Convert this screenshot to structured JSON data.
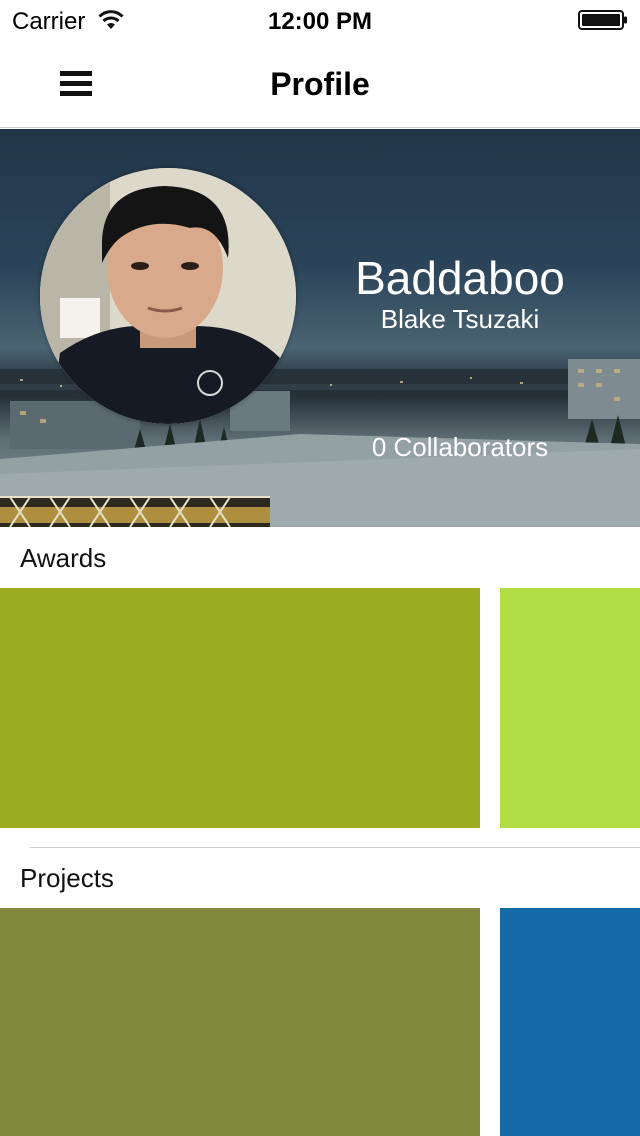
{
  "status_bar": {
    "carrier": "Carrier",
    "time": "12:00 PM",
    "icons": [
      "wifi-icon",
      "battery-icon"
    ]
  },
  "nav": {
    "title": "Profile",
    "menu_icon": "hamburger-menu-icon"
  },
  "profile": {
    "username": "Baddaboo",
    "full_name": "Blake Tsuzaki",
    "collaborators": "0 Collaborators"
  },
  "sections": {
    "awards": {
      "title": "Awards",
      "tiles": [
        {
          "color": "#9aad22"
        },
        {
          "color": "#b1de45"
        }
      ]
    },
    "projects": {
      "title": "Projects",
      "tiles": [
        {
          "color": "#80893b"
        },
        {
          "color": "#156aa8"
        }
      ]
    }
  }
}
